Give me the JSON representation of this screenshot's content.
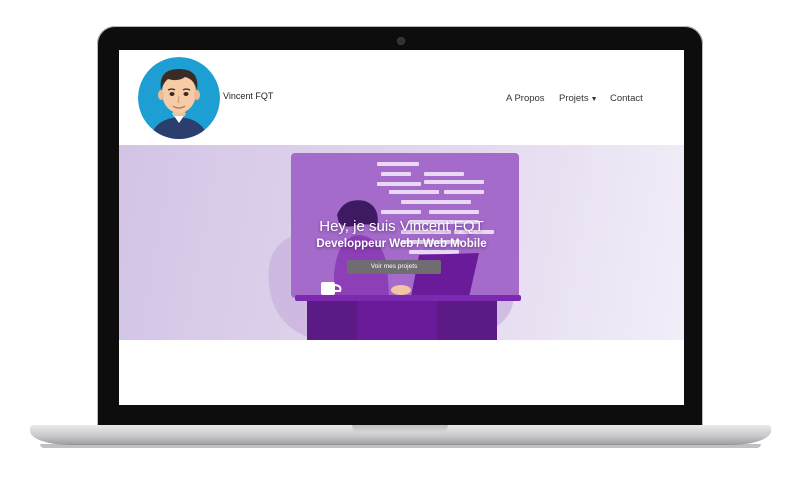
{
  "site": {
    "brand": "Vincent FQT"
  },
  "nav": {
    "items": [
      {
        "label": "A Propos"
      },
      {
        "label": "Projets",
        "dropdown": true
      },
      {
        "label": "Contact"
      }
    ]
  },
  "hero": {
    "title": "Hey, je suis Vincent FQT",
    "subtitle": "Developpeur Web / Web Mobile",
    "button_label": "Voir mes projets"
  },
  "colors": {
    "hero_purple": "#9b5cc6",
    "desk_purple": "#6a1b9a",
    "avatar_bg": "#1e9fd4",
    "button_gray": "#6f6d72"
  }
}
